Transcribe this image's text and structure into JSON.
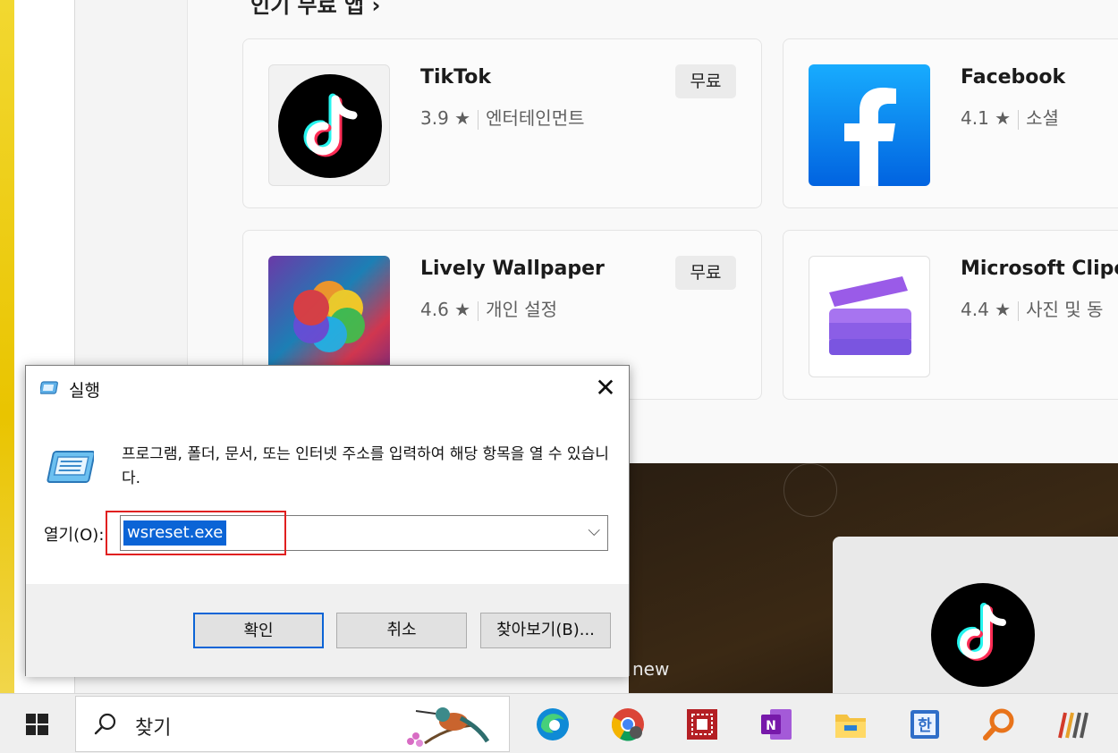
{
  "store": {
    "section_title": "인기 무료 앱 ›",
    "apps": [
      {
        "name": "TikTok",
        "rating": "3.9 ★",
        "category": "엔터테인먼트",
        "price": "무료"
      },
      {
        "name": "Facebook",
        "rating": "4.1 ★",
        "category": "소셜"
      },
      {
        "name": "Lively Wallpaper",
        "rating": "4.6 ★",
        "category": "개인 설정",
        "price": "무료"
      },
      {
        "name": "Microsoft Clipch",
        "rating": "4.4 ★",
        "category": "사진 및 동"
      }
    ],
    "promo_text": "new"
  },
  "run_dialog": {
    "title": "실행",
    "description": "프로그램, 폴더, 문서, 또는 인터넷 주소를 입력하여 해당 항목을 열 수 있습니다.",
    "open_label": "열기(O):",
    "open_value": "wsreset.exe",
    "ok_label": "확인",
    "cancel_label": "취소",
    "browse_label": "찾아보기(B)...",
    "close_glyph": "✕"
  },
  "taskbar": {
    "search_placeholder": "찾기",
    "icons": [
      "edge-icon",
      "chrome-icon",
      "app-red-icon",
      "onenote-icon",
      "file-explorer-icon",
      "hangul-icon",
      "search-tool-icon",
      "app-stripes-icon"
    ]
  },
  "colors": {
    "accent": "#0b64d6",
    "highlight_box": "#e02020"
  }
}
